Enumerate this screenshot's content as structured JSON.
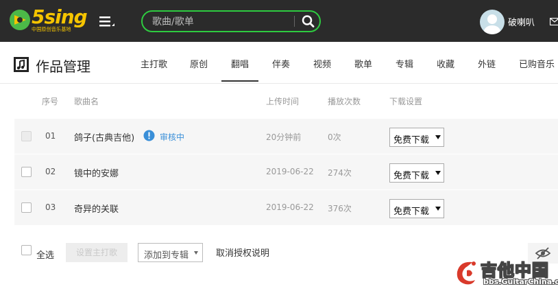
{
  "header": {
    "logo_text": "5sing",
    "logo_subtitle": "中国原创音乐基地",
    "search_placeholder": "歌曲/歌单",
    "username": "破喇叭",
    "icons": [
      "menu-icon",
      "search-icon",
      "avatar",
      "mail-icon"
    ],
    "accent_color": "#2ecc40",
    "logo_color": "#f5c400"
  },
  "subheader": {
    "title": "作品管理",
    "tabs": [
      {
        "label": "主打歌",
        "active": false
      },
      {
        "label": "原创",
        "active": false
      },
      {
        "label": "翻唱",
        "active": true
      },
      {
        "label": "伴奏",
        "active": false
      },
      {
        "label": "视频",
        "active": false
      },
      {
        "label": "歌单",
        "active": false
      },
      {
        "label": "专辑",
        "active": false
      },
      {
        "label": "收藏",
        "active": false
      },
      {
        "label": "外链",
        "active": false
      },
      {
        "label": "已购音乐",
        "active": false
      }
    ]
  },
  "table": {
    "columns": {
      "index": "序号",
      "song": "歌曲名",
      "upload_time": "上传时间",
      "plays": "播放次数",
      "download": "下载设置"
    },
    "rows": [
      {
        "index": "01",
        "song": "鸽子(古典吉他)",
        "status": "审核中",
        "upload_time": "20分钟前",
        "plays": "0次",
        "download": "免费下载",
        "checkbox_disabled": true
      },
      {
        "index": "02",
        "song": "镜中的安娜",
        "status": "",
        "upload_time": "2019-06-22",
        "plays": "274次",
        "download": "免费下载",
        "checkbox_disabled": false
      },
      {
        "index": "03",
        "song": "奇异的关联",
        "status": "",
        "upload_time": "2019-06-22",
        "plays": "376次",
        "download": "免费下载",
        "checkbox_disabled": false
      }
    ]
  },
  "footer": {
    "select_all": "全选",
    "set_main": "设置主打歌",
    "add_to_album": "添加到专辑",
    "revoke": "取消授权说明"
  },
  "watermark": {
    "text": "吉他中国",
    "url": "bbs.GuitarChina.com"
  }
}
